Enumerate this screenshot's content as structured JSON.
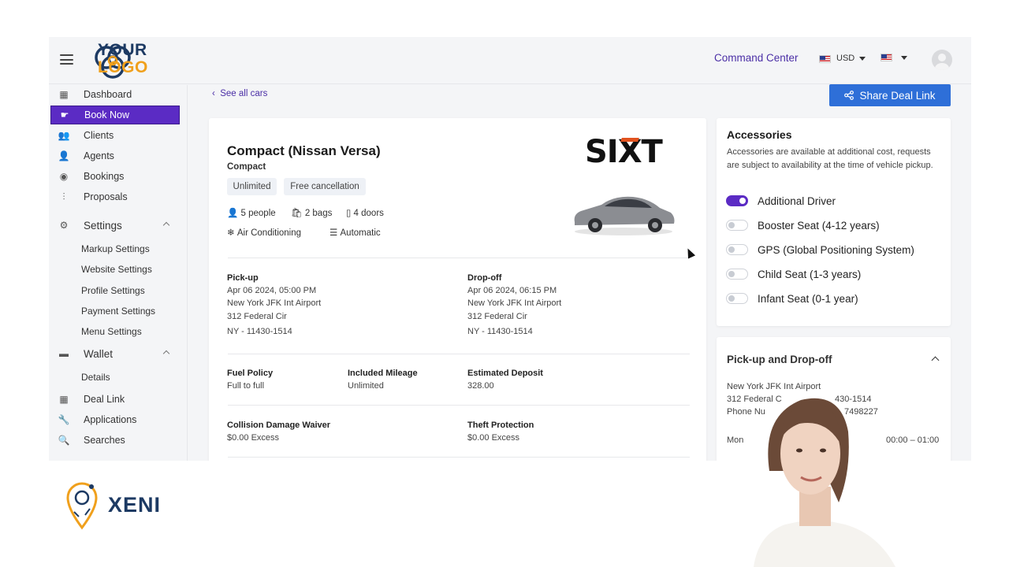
{
  "header": {
    "logo_line1": "YOUR",
    "logo_line2": "LOGO",
    "command_center": "Command Center",
    "currency": "USD"
  },
  "sidebar": {
    "items": [
      {
        "label": "Dashboard",
        "icon": "grid-icon"
      },
      {
        "label": "Book Now",
        "icon": "hand-point-icon",
        "active": true
      },
      {
        "label": "Clients",
        "icon": "users-icon"
      },
      {
        "label": "Agents",
        "icon": "user-icon"
      },
      {
        "label": "Bookings",
        "icon": "compass-icon"
      },
      {
        "label": "Proposals",
        "icon": "sliders-icon"
      }
    ],
    "settings": {
      "label": "Settings",
      "icon": "gear-icon",
      "children": [
        "Markup Settings",
        "Website Settings",
        "Profile Settings",
        "Payment Settings",
        "Menu Settings"
      ]
    },
    "wallet": {
      "label": "Wallet",
      "icon": "wallet-icon",
      "children": [
        "Details"
      ]
    },
    "bottom_items": [
      {
        "label": "Deal Link",
        "icon": "grid-icon"
      },
      {
        "label": "Applications",
        "icon": "wrench-icon"
      },
      {
        "label": "Searches",
        "icon": "search-icon"
      }
    ]
  },
  "main": {
    "back_link": "See all cars",
    "share_button": "Share Deal Link",
    "car_title": "Compact (Nissan Versa)",
    "car_class": "Compact",
    "badges": [
      "Unlimited",
      "Free cancellation"
    ],
    "features": {
      "people": "5 people",
      "bags": "2 bags",
      "doors": "4 doors",
      "ac": "Air Conditioning",
      "transmission": "Automatic"
    },
    "vendor_logo": "SIXT",
    "pickup": {
      "label": "Pick-up",
      "datetime": "Apr 06 2024, 05:00 PM",
      "location": "New York JFK Int Airport",
      "address": "312 Federal Cir",
      "zip": "NY - 11430-1514"
    },
    "dropoff": {
      "label": "Drop-off",
      "datetime": "Apr 06 2024, 06:15 PM",
      "location": "New York JFK Int Airport",
      "address": "312 Federal Cir",
      "zip": "NY - 11430-1514"
    },
    "fuel_policy": {
      "label": "Fuel Policy",
      "value": "Full to full"
    },
    "mileage": {
      "label": "Included Mileage",
      "value": "Unlimited"
    },
    "deposit": {
      "label": "Estimated Deposit",
      "value": "328.00"
    },
    "cdw": {
      "label": "Collision Damage Waiver",
      "value": "$0.00 Excess"
    },
    "theft": {
      "label": "Theft Protection",
      "value": "$0.00 Excess"
    }
  },
  "accessories": {
    "title": "Accessories",
    "description": "Accessories are available at additional cost, requests are subject to availability at the time of vehicle pickup.",
    "items": [
      {
        "label": "Additional Driver",
        "on": true
      },
      {
        "label": "Booster Seat (4-12 years)",
        "on": false
      },
      {
        "label": "GPS (Global Positioning System)",
        "on": false
      },
      {
        "label": "Child Seat (1-3 years)",
        "on": false
      },
      {
        "label": "Infant Seat (0-1 year)",
        "on": false
      }
    ]
  },
  "pickup_dropoff_panel": {
    "title": "Pick-up and Drop-off",
    "location": "New York JFK Int Airport",
    "address_partial": "312 Federal C",
    "address_tail": "430-1514",
    "phone_partial": "Phone Nu",
    "phone_tail": "7498227",
    "day": "Mon",
    "hours": "00:00 – 01:00"
  },
  "branding": {
    "xeni": "XENI"
  },
  "colors": {
    "accent": "#5b2bc4",
    "primary_button": "#2e6fd8",
    "logo_navy": "#1d3a63",
    "logo_orange": "#f0a01c",
    "sixt_orange": "#e2531f"
  }
}
